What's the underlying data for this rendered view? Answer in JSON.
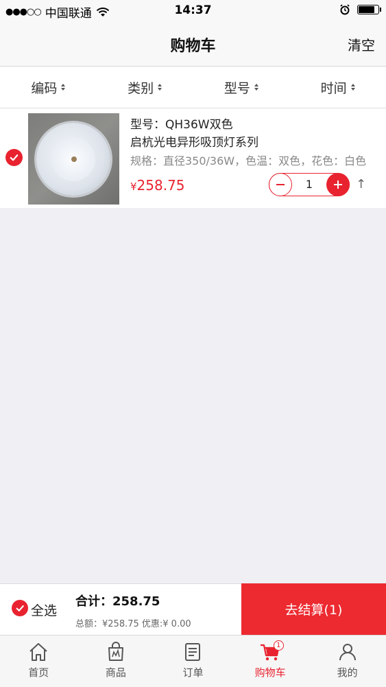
{
  "status_bar": {
    "signal": "●●●○○",
    "carrier": "中国联通",
    "time": "14:37",
    "battery_level": 0.75
  },
  "nav": {
    "title": "购物车",
    "clear_label": "清空"
  },
  "sort_bar": {
    "items": [
      {
        "label": "编码"
      },
      {
        "label": "类别"
      },
      {
        "label": "型号"
      },
      {
        "label": "时间"
      }
    ]
  },
  "cart_items": [
    {
      "selected": true,
      "model_line": "型号：QH36W双色",
      "name_line": "启杭光电异形吸顶灯系列",
      "spec": "规格：直径350/36W，色温：双色，花色：白色",
      "currency": "¥",
      "price": "258.75",
      "quantity": "1",
      "collapse_icon": "↑"
    }
  ],
  "summary": {
    "select_all_label": "全选",
    "total_label": "合计：258.75",
    "detail": "总额：¥258.75 优惠:¥ 0.00",
    "checkout_label": "去结算(1)"
  },
  "tab_bar": {
    "tabs": [
      {
        "label": "首页",
        "icon": "home-icon"
      },
      {
        "label": "商品",
        "icon": "shopping-bag-icon"
      },
      {
        "label": "订单",
        "icon": "order-list-icon"
      },
      {
        "label": "购物车",
        "icon": "cart-icon",
        "badge": "1",
        "active": true
      },
      {
        "label": "我的",
        "icon": "user-icon"
      }
    ]
  },
  "colors": {
    "accent": "#e8232f",
    "checkout_bg": "#ec2a30",
    "page_bg": "#efeff4"
  }
}
